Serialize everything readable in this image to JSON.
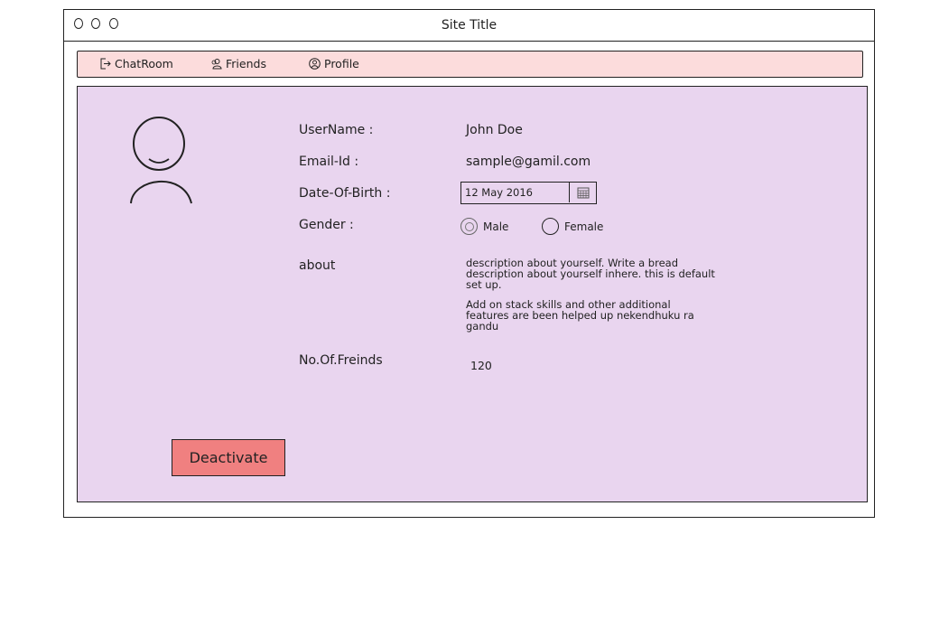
{
  "window": {
    "title": "Site Title"
  },
  "nav": {
    "items": [
      {
        "label": "ChatRoom",
        "icon": "logout-icon"
      },
      {
        "label": "Friends",
        "icon": "users-icon"
      },
      {
        "label": "Profile",
        "icon": "profile-icon"
      }
    ]
  },
  "profile": {
    "username_label": "UserName :",
    "username_value": "John Doe",
    "email_label": "Email-Id :",
    "email_value": "sample@gamil.com",
    "dob_label": "Date-Of-Birth :",
    "dob_value": "12 May 2016",
    "gender_label": "Gender :",
    "gender_options": [
      {
        "label": "Male",
        "selected": true
      },
      {
        "label": "Female",
        "selected": false
      }
    ],
    "about_label": "about",
    "about_paragraphs": [
      "description about yourself. Write a bread description about yourself inhere. this is default set up.",
      "Add on stack skills and other additional features are been helped up nekendhuku ra gandu"
    ],
    "friends_label": "No.Of.Freinds",
    "friends_value": "120",
    "deactivate_label": "Deactivate"
  },
  "colors": {
    "navbar_bg": "#fcdcdc",
    "panel_bg": "#e9d5ef",
    "deactivate_bg": "#f08080"
  }
}
